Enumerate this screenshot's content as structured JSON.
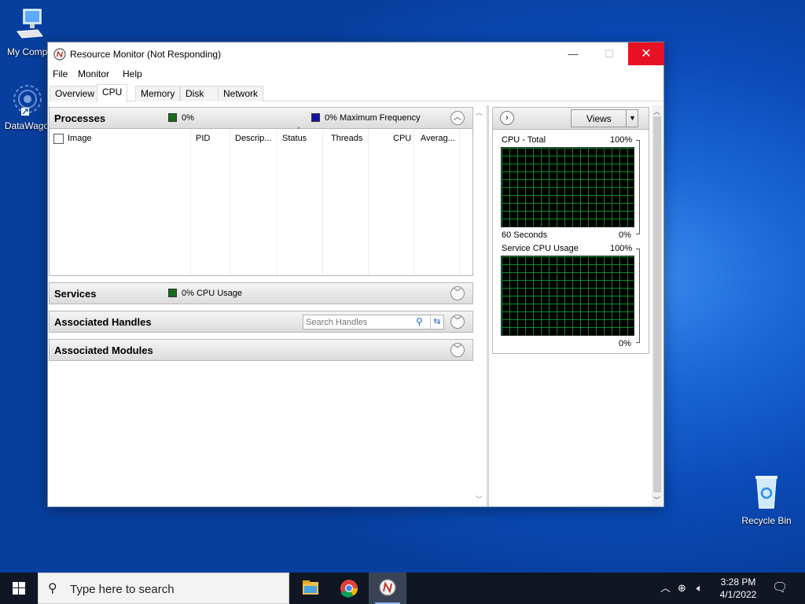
{
  "desktop": {
    "icons": [
      {
        "label": "My Compu"
      },
      {
        "label": "DataWago"
      },
      {
        "label": "Recycle Bin"
      }
    ]
  },
  "window": {
    "title": "Resource Monitor (Not Responding)",
    "controls": {
      "minimize": "—",
      "maximize": "☐",
      "close": "✕"
    }
  },
  "menu": [
    "File",
    "Monitor",
    "Help"
  ],
  "tabs": [
    "Overview",
    "CPU",
    "Memory",
    "Disk",
    "Network"
  ],
  "active_tab": "CPU",
  "processes": {
    "title": "Processes",
    "cpu_pct": "0%",
    "max_freq": "0% Maximum Frequency",
    "columns": [
      "Image",
      "PID",
      "Descrip...",
      "Status",
      "Threads",
      "CPU",
      "Averag..."
    ]
  },
  "services": {
    "title": "Services",
    "cpu_usage": "0% CPU Usage"
  },
  "handles": {
    "title": "Associated Handles",
    "search_placeholder": "Search Handles"
  },
  "modules": {
    "title": "Associated Modules"
  },
  "graphs": {
    "views_label": "Views",
    "cpu_total": {
      "label": "CPU - Total",
      "max": "100%",
      "time": "60 Seconds",
      "min": "0%"
    },
    "service_cpu": {
      "label": "Service CPU Usage",
      "max": "100%",
      "min": "0%"
    }
  },
  "colors": {
    "cpu_legend": "#1a6b1a",
    "freq_legend": "#1414a8",
    "graph_grid": "#0b8a2a",
    "close_red": "#e81123"
  },
  "taskbar": {
    "search_placeholder": "Type here to search",
    "time": "3:28 PM",
    "date": "4/1/2022",
    "apps": [
      "file-explorer-icon",
      "chrome-icon",
      "resource-monitor-icon"
    ]
  }
}
